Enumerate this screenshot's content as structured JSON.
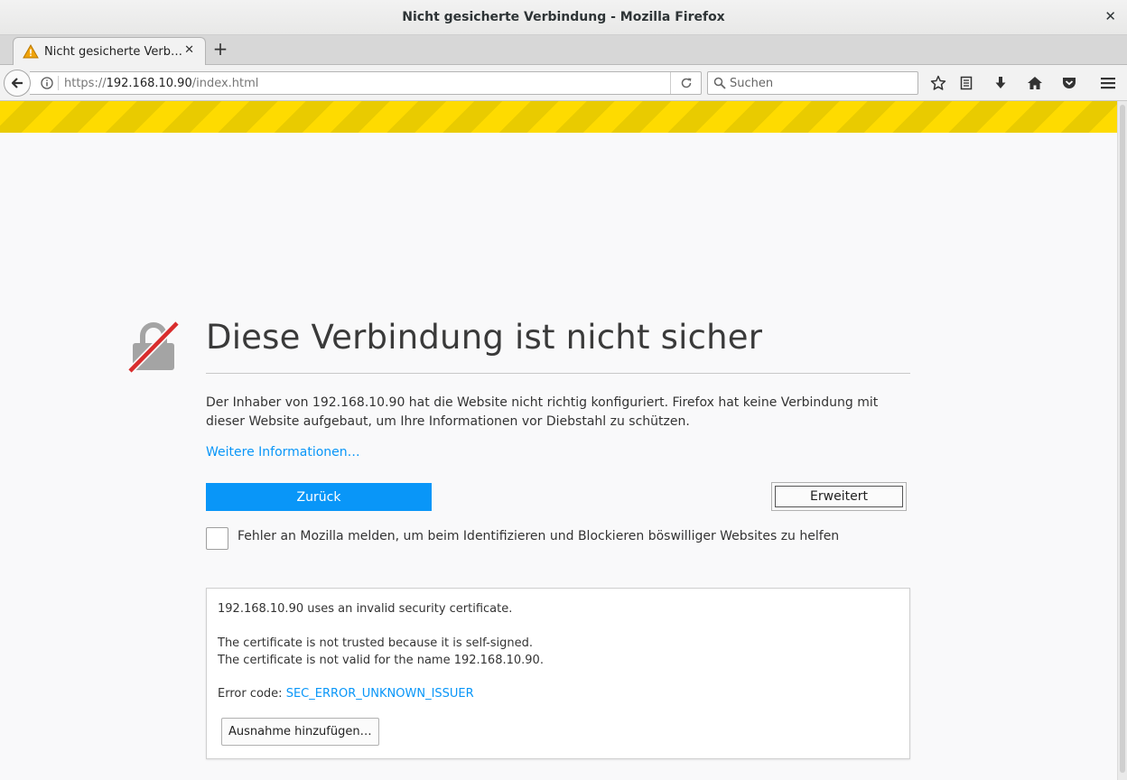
{
  "window": {
    "title": "Nicht gesicherte Verbindung - Mozilla Firefox",
    "close_glyph": "✕"
  },
  "tabs": [
    {
      "label": "Nicht gesicherte Verb…",
      "close_glyph": "✕",
      "icon": "warning-icon"
    }
  ],
  "newtab_glyph": "+",
  "navbar": {
    "url_prefix": "https://",
    "url_host": "192.168.10.90",
    "url_path": "/index.html",
    "search_placeholder": "Suchen",
    "icons": [
      "back-icon",
      "info-icon",
      "reload-icon",
      "search-icon",
      "bookmark-star-icon",
      "reading-list-icon",
      "download-icon",
      "home-icon",
      "pocket-icon",
      "menu-icon"
    ]
  },
  "error": {
    "headline": "Diese Verbindung ist nicht sicher",
    "description": "Der Inhaber von 192.168.10.90 hat die Website nicht richtig konfiguriert. Firefox hat keine Verbindung mit dieser Website aufgebaut, um Ihre Informationen vor Diebstahl zu schützen.",
    "more_info": "Weitere Informationen…",
    "back_button": "Zurück",
    "advanced_button": "Erweitert",
    "report_label": "Fehler an Mozilla melden, um beim Identifizieren und Blockieren böswilliger Websites zu helfen"
  },
  "details": {
    "line1": "192.168.10.90 uses an invalid security certificate.",
    "line2": "The certificate is not trusted because it is self-signed.",
    "line3": "The certificate is not valid for the name 192.168.10.90.",
    "error_code_label": "Error code: ",
    "error_code": "SEC_ERROR_UNKNOWN_ISSUER",
    "add_exception_button": "Ausnahme hinzufügen…"
  },
  "colors": {
    "accent": "#0996f8",
    "stripe_yellow": "#fedb00",
    "lock_red": "#d92d2d"
  }
}
